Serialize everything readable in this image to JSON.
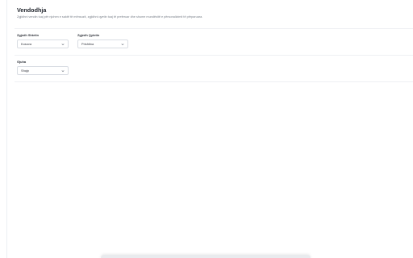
{
  "header": {
    "title": "Vendodhja",
    "subtitle": "Zgjidhni vendin tuaj për njohen e saktë të mënsozit, zgjidhni qyetin tuaj të preferuar dhe shume mundësitë e përsonalizimit të përparuara."
  },
  "fields": {
    "country": {
      "label": "Zgjedh Shtetin",
      "value": "Kosova"
    },
    "city": {
      "label": "Zgjedh Qytetin",
      "value": "Prishtina"
    },
    "language": {
      "label": "Gjuha",
      "value": "Shqip"
    }
  },
  "icons": {
    "select_arrow": "chevron-down-icon"
  },
  "colors": {
    "border": "#d9dde3",
    "divider": "#eef0f3",
    "text": "#2b2f38",
    "muted": "#7a808a"
  }
}
